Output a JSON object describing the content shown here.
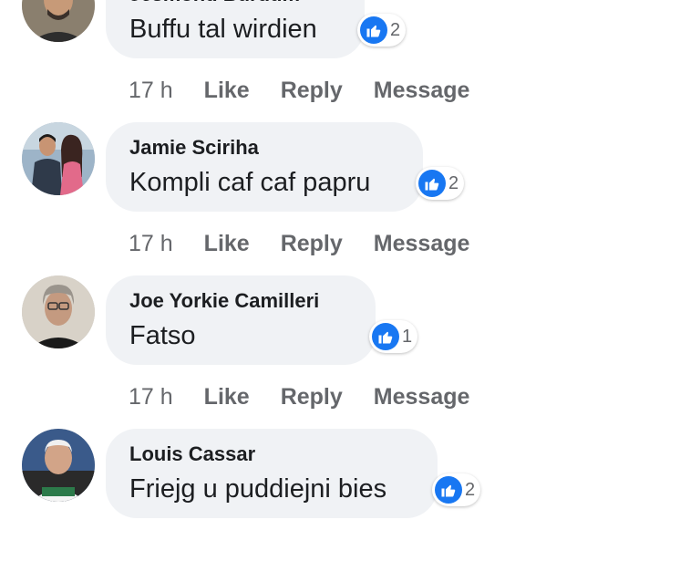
{
  "comments": [
    {
      "author": "Jesmond Burdum",
      "text": "Buffu tal wirdien",
      "reactions": {
        "icon": "like-icon",
        "count": "2"
      },
      "time": "17 h",
      "actions": {
        "like": "Like",
        "reply": "Reply",
        "message": "Message"
      }
    },
    {
      "author": "Jamie Sciriha",
      "text": "Kompli caf caf papru",
      "reactions": {
        "icon": "like-icon",
        "count": "2"
      },
      "time": "17 h",
      "actions": {
        "like": "Like",
        "reply": "Reply",
        "message": "Message"
      }
    },
    {
      "author": "Joe Yorkie Camilleri",
      "text": "Fatso",
      "reactions": {
        "icon": "like-icon",
        "count": "1"
      },
      "time": "17 h",
      "actions": {
        "like": "Like",
        "reply": "Reply",
        "message": "Message"
      }
    },
    {
      "author": "Louis Cassar",
      "text": "Friejg u puddiejni bies",
      "reactions": {
        "icon": "like-icon",
        "count": "2"
      },
      "time": "",
      "actions": {
        "like": "",
        "reply": "",
        "message": ""
      }
    }
  ],
  "colors": {
    "like_blue": "#1877f2",
    "bubble_bg": "#f0f2f5",
    "meta_gray": "#65676b"
  }
}
